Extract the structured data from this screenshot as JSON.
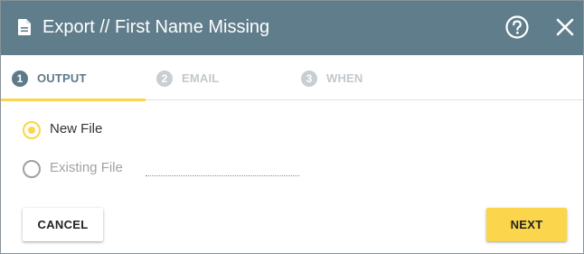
{
  "dialog": {
    "title": "Export // First Name Missing",
    "header_color": "#607d8b",
    "icons": {
      "title": "document-icon",
      "help": "help-circle-icon",
      "close": "close-icon"
    }
  },
  "tabs": [
    {
      "number": "1",
      "label": "OUTPUT",
      "active": true
    },
    {
      "number": "2",
      "label": "EMAIL",
      "active": false
    },
    {
      "number": "3",
      "label": "WHEN",
      "active": false
    }
  ],
  "output_options": [
    {
      "label": "New File",
      "selected": true,
      "enabled": true
    },
    {
      "label": "Existing File",
      "selected": false,
      "enabled": false
    }
  ],
  "existing_file": {
    "value": "",
    "placeholder": ""
  },
  "buttons": {
    "cancel": "CANCEL",
    "next": "NEXT"
  },
  "colors": {
    "accent": "#fbd54b",
    "active_tab": "#5e7a88",
    "inactive_tab": "#c2c8cc"
  }
}
